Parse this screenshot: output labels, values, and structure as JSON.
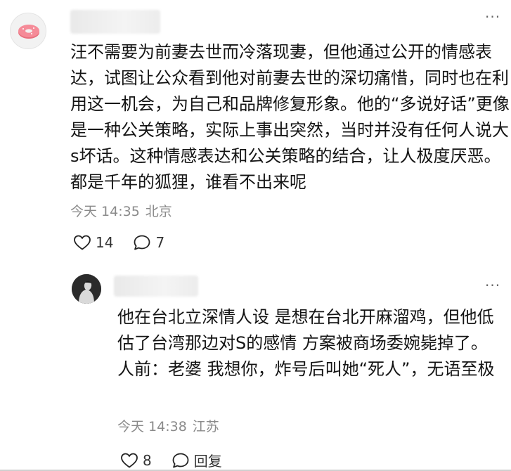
{
  "comments": [
    {
      "text": "汪不需要为前妻去世而冷落现妻，但他通过公开的情感表达，试图让公众看到他对前妻去世的深切痛惜，同时也在利用这一机会，为自己和品牌修复形象。他的“多说好话”更像是一种公关策略，实际上事出突然，当时并没有任何人说大s坏话。这种情感表达和公关策略的结合，让人极度厌恶。都是千年的狐狸，谁看不出来呢",
      "time": "今天 14:35",
      "location": "北京",
      "likes": "14",
      "replies": "7",
      "avatar_icon": "donut-avatar-icon"
    },
    {
      "text": "他在台北立深情人设 是想在台北开麻溜鸡，但他低估了台湾那边对S的感情 方案被商场委婉毙掉了。人前：老婆 我想你，炸号后叫她“死人”，无语至极",
      "time": "今天 14:38",
      "location": "江苏",
      "likes": "8",
      "reply_label": "回复",
      "avatar_icon": "person-avatar-icon"
    }
  ],
  "more_glyph": "···"
}
